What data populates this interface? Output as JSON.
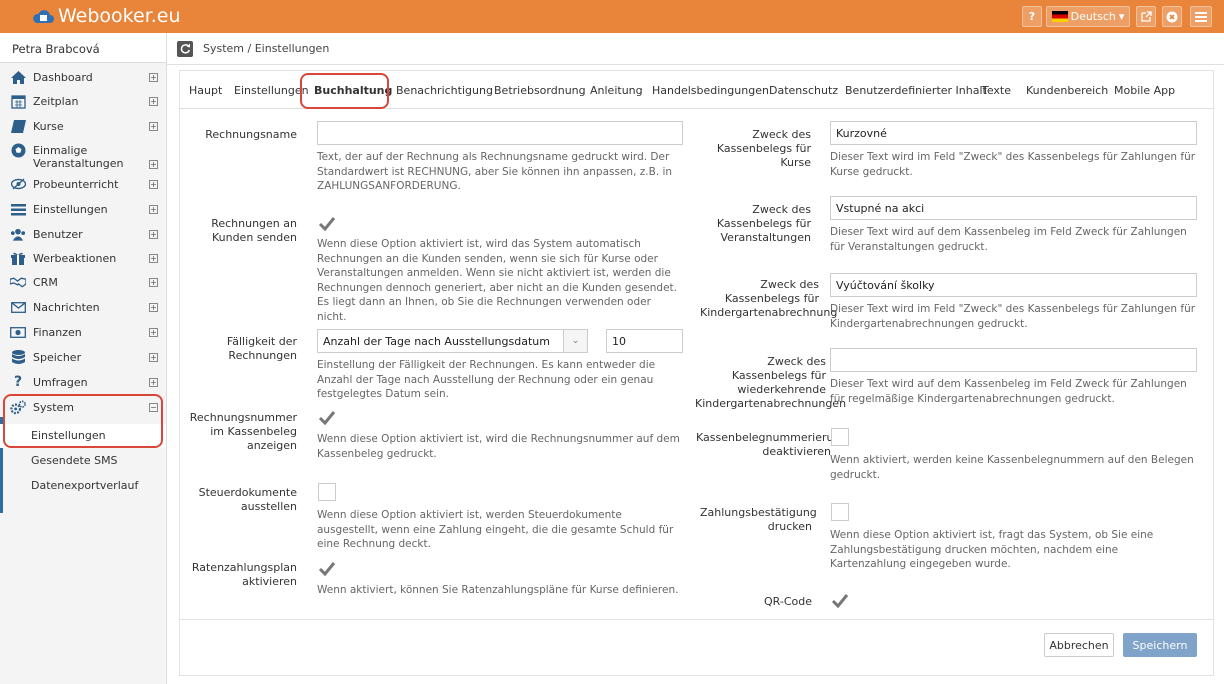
{
  "app": {
    "logo_text": "Webooker.eu"
  },
  "topbar": {
    "help": "?",
    "language": "Deutsch",
    "language_caret": "▾"
  },
  "user": {
    "name": "Petra Brabcová"
  },
  "sidebar": {
    "items": [
      {
        "label": "Dashboard",
        "icon": "home-icon"
      },
      {
        "label": "Zeitplan",
        "icon": "calendar-icon"
      },
      {
        "label": "Kurse",
        "icon": "book-icon"
      },
      {
        "label": "Einmalige Veranstaltungen",
        "icon": "soccer-ball-icon"
      },
      {
        "label": "Probeunterricht",
        "icon": "eye-slash-icon"
      },
      {
        "label": "Einstellungen",
        "icon": "settings-icon"
      },
      {
        "label": "Benutzer",
        "icon": "users-icon"
      },
      {
        "label": "Werbeaktionen",
        "icon": "gift-icon"
      },
      {
        "label": "CRM",
        "icon": "handshake-icon"
      },
      {
        "label": "Nachrichten",
        "icon": "envelope-icon"
      },
      {
        "label": "Finanzen",
        "icon": "money-icon"
      },
      {
        "label": "Speicher",
        "icon": "database-icon"
      },
      {
        "label": "Umfragen",
        "icon": "question-icon"
      },
      {
        "label": "System",
        "icon": "gears-icon"
      }
    ],
    "system_sub": [
      "Einstellungen",
      "Gesendete SMS",
      "Datenexportverlauf"
    ],
    "expand_symbol": "⊞",
    "collapse_symbol": "⊟"
  },
  "breadcrumb": "System / Einstellungen",
  "tabs": [
    "Haupt",
    "Einstellungen",
    "Buchhaltung",
    "Benachrichtigung",
    "Betriebsordnung",
    "Anleitung",
    "Handelsbedingungen",
    "Datenschutz",
    "Benutzerdefinierter Inhalt",
    "Texte",
    "Kundenbereich",
    "Mobile App"
  ],
  "active_tab": "Buchhaltung",
  "left": {
    "invoice_name": {
      "label": "Rechnungsname",
      "value": "",
      "help": "Text, der auf der Rechnung als Rechnungsname gedruckt wird. Der Standardwert ist RECHNUNG, aber Sie können ihn anpassen, z.B. in ZAHLUNGSANFORDERUNG."
    },
    "send_invoices": {
      "label": "Rechnungen an Kunden senden",
      "checked": true,
      "help": "Wenn diese Option aktiviert ist, wird das System automatisch Rechnungen an die Kunden senden, wenn sie sich für Kurse oder Veranstaltungen anmelden. Wenn sie nicht aktiviert ist, werden die Rechnungen dennoch generiert, aber nicht an die Kunden gesendet. Es liegt dann an Ihnen, ob Sie die Rechnungen verwenden oder nicht."
    },
    "due_date": {
      "label": "Fälligkeit der Rechnungen",
      "select_value": "Anzahl der Tage nach Ausstellungsdatum",
      "days_value": "10",
      "help": "Einstellung der Fälligkeit der Rechnungen. Es kann entweder die Anzahl der Tage nach Ausstellung der Rechnung oder ein genau festgelegtes Datum sein."
    },
    "show_invoice_number": {
      "label": "Rechnungsnummer im Kassenbeleg anzeigen",
      "checked": true,
      "help": "Wenn diese Option aktiviert ist, wird die Rechnungsnummer auf dem Kassenbeleg gedruckt."
    },
    "tax_documents": {
      "label": "Steuerdokumente ausstellen",
      "checked": false,
      "help": "Wenn diese Option aktiviert ist, werden Steuerdokumente ausgestellt, wenn eine Zahlung eingeht, die die gesamte Schuld für eine Rechnung deckt."
    },
    "installment_plan": {
      "label": "Ratenzahlungsplan aktivieren",
      "checked": true,
      "help": "Wenn aktiviert, können Sie Ratenzahlungspläne für Kurse definieren."
    }
  },
  "right": {
    "purpose_courses": {
      "label": "Zweck des Kassenbelegs für Kurse",
      "value": "Kurzovné",
      "help": "Dieser Text wird im Feld \"Zweck\" des Kassenbelegs für Zahlungen für Kurse gedruckt."
    },
    "purpose_events": {
      "label": "Zweck des Kassenbelegs für Veranstaltungen",
      "value": "Vstupné na akci",
      "help": "Dieser Text wird auf dem Kassenbeleg im Feld Zweck für Zahlungen für Veranstaltungen gedruckt."
    },
    "purpose_kindergarten": {
      "label": "Zweck des Kassenbelegs für Kindergartenabrechnung",
      "value": "Vyúčtování školky",
      "help": "Dieser Text wird im Feld \"Zweck\" des Kassenbelegs für Zahlungen für Kindergartenabrechnungen gedruckt."
    },
    "purpose_recurring": {
      "label": "Zweck des Kassenbelegs für wiederkehrende Kindergartenabrechnungen",
      "value": "",
      "help": "Dieser Text wird auf dem Kassenbeleg im Feld Zweck für Zahlungen für regelmäßige Kindergartenabrechnungen gedruckt."
    },
    "disable_numbering": {
      "label": "Kassenbelegnummerierung deaktivieren",
      "checked": false,
      "help": "Wenn aktiviert, werden keine Kassenbelegnummern auf den Belegen gedruckt."
    },
    "print_confirmation": {
      "label": "Zahlungsbestätigung drucken",
      "checked": false,
      "help": "Wenn diese Option aktiviert ist, fragt das System, ob Sie eine Zahlungsbestätigung drucken möchten, nachdem eine Kartenzahlung eingegeben wurde."
    },
    "qr_code": {
      "label": "QR-Code",
      "checked": true
    }
  },
  "buttons": {
    "cancel": "Abbrechen",
    "save": "Speichern"
  },
  "colors": {
    "topbar": "#e8853a",
    "highlight": "#d9473b",
    "save_button": "#7fa3c9",
    "sidebar_icon": "#2e5e8a"
  }
}
